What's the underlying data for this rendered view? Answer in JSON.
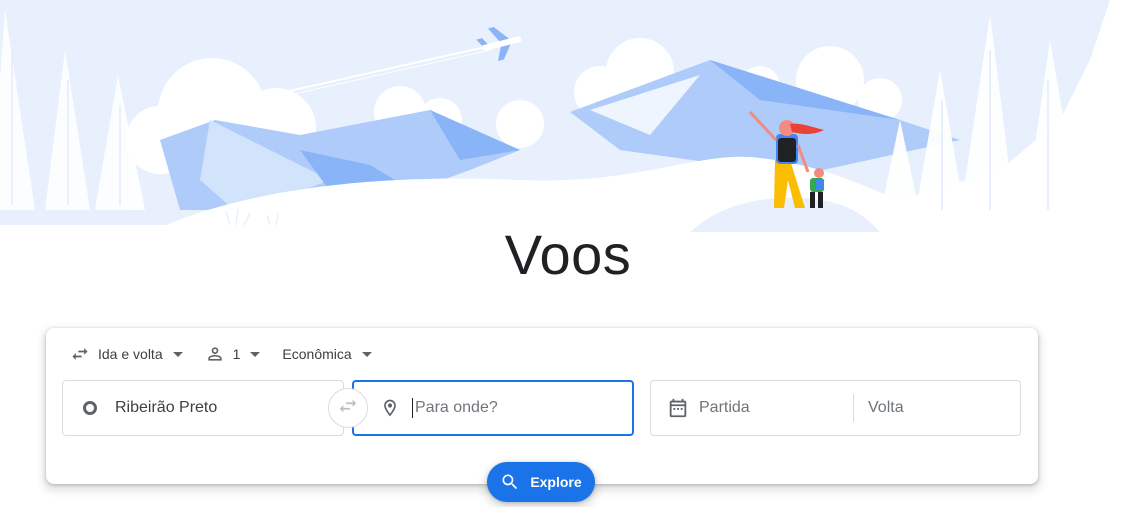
{
  "page": {
    "title": "Voos"
  },
  "trip_options": {
    "trip_type": "Ida e volta",
    "passengers": "1",
    "cabin_class": "Econômica"
  },
  "search": {
    "origin_value": "Ribeirão Preto",
    "destination_placeholder": "Para onde?",
    "departure_placeholder": "Partida",
    "return_placeholder": "Volta",
    "explore_label": "Explore"
  },
  "icons": {
    "trip_type": "swap-horiz-icon",
    "passengers": "person-icon",
    "origin": "circle-icon",
    "swap": "swap-arrows-icon",
    "destination": "location-pin-icon",
    "dates": "calendar-icon",
    "explore": "search-icon"
  },
  "colors": {
    "accent": "#1a73e8",
    "hero_sky": "#e8f0fe",
    "hero_mountains": "#aecbfa"
  }
}
